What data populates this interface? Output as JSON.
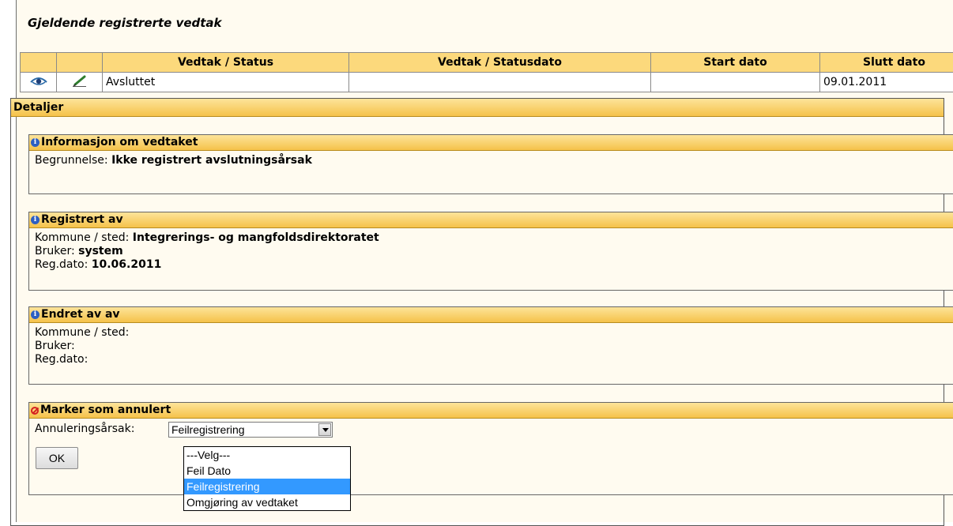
{
  "page_title": "Gjeldende registrerte vedtak",
  "table": {
    "headers": [
      "Vedtak / Status",
      "Vedtak / Statusdato",
      "Start dato",
      "Slutt dato"
    ],
    "row": {
      "status": "Avsluttet",
      "statusdato": "",
      "start_dato": "",
      "slutt_dato": "09.01.2011"
    }
  },
  "details": {
    "title": "Detaljer",
    "info": {
      "title": "Informasjon om vedtaket",
      "begrunnelse_label": "Begrunnelse:",
      "begrunnelse_value": "Ikke registrert avslutningsårsak"
    },
    "registrert": {
      "title": "Registrert av",
      "kommune_label": "Kommune / sted:",
      "kommune_value": "Integrerings- og mangfoldsdirektoratet",
      "bruker_label": "Bruker:",
      "bruker_value": "system",
      "regdato_label": "Reg.dato:",
      "regdato_value": "10.06.2011"
    },
    "endret": {
      "title": "Endret av av",
      "kommune_label": "Kommune / sted:",
      "bruker_label": "Bruker:",
      "regdato_label": "Reg.dato:"
    },
    "annuler": {
      "title": "Marker som annulert",
      "aarsak_label": "Annuleringsårsak:",
      "selected": "Feilregistrering",
      "options": [
        "---Velg---",
        "Feil Dato",
        "Feilregistrering",
        "Omgjøring av vedtaket"
      ],
      "ok_label": "OK"
    }
  },
  "colors": {
    "header_bg": "#fcd97c",
    "page_bg": "#fffbf0",
    "highlight": "#3399ff"
  }
}
